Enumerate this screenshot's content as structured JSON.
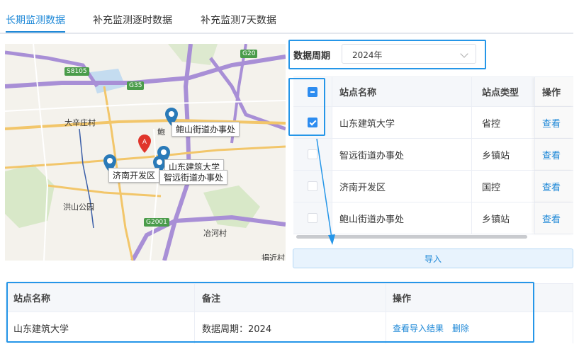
{
  "tabs": [
    {
      "label": "长期监测数据",
      "active": true
    },
    {
      "label": "补充监测逐时数据",
      "active": false
    },
    {
      "label": "补充监测7天数据",
      "active": false
    }
  ],
  "map": {
    "places": [
      "大辛庄村",
      "洪山公园",
      "冶河村",
      "鲍",
      "捐近村"
    ],
    "highways": [
      "G20",
      "S8105",
      "G35",
      "G2001"
    ],
    "callouts": [
      "鲍山街道办事处",
      "山东建筑大学",
      "济南开发区",
      "智远街道办事处"
    ],
    "marker_letter": "A"
  },
  "filter": {
    "period_label": "数据周期",
    "period_value": "2024年"
  },
  "station_table": {
    "columns": [
      "站点名称",
      "站点类型",
      "操作"
    ],
    "rows": [
      {
        "name": "山东建筑大学",
        "type": "省控",
        "action": "查看",
        "checked": true
      },
      {
        "name": "智远街道办事处",
        "type": "乡镇站",
        "action": "查看",
        "checked": false
      },
      {
        "name": "济南开发区",
        "type": "国控",
        "action": "查看",
        "checked": false
      },
      {
        "name": "鲍山街道办事处",
        "type": "乡镇站",
        "action": "查看",
        "checked": false
      }
    ]
  },
  "import_button": "导入",
  "import_table": {
    "columns": [
      "站点名称",
      "备注",
      "操作"
    ],
    "rows": [
      {
        "name": "山东建筑大学",
        "note": "数据周期：2024",
        "actions": [
          "查看导入结果",
          "删除"
        ]
      }
    ]
  },
  "colors": {
    "accent": "#1e88d7",
    "highlight": "#2596e8",
    "checkbox": "#2d8cf0"
  }
}
